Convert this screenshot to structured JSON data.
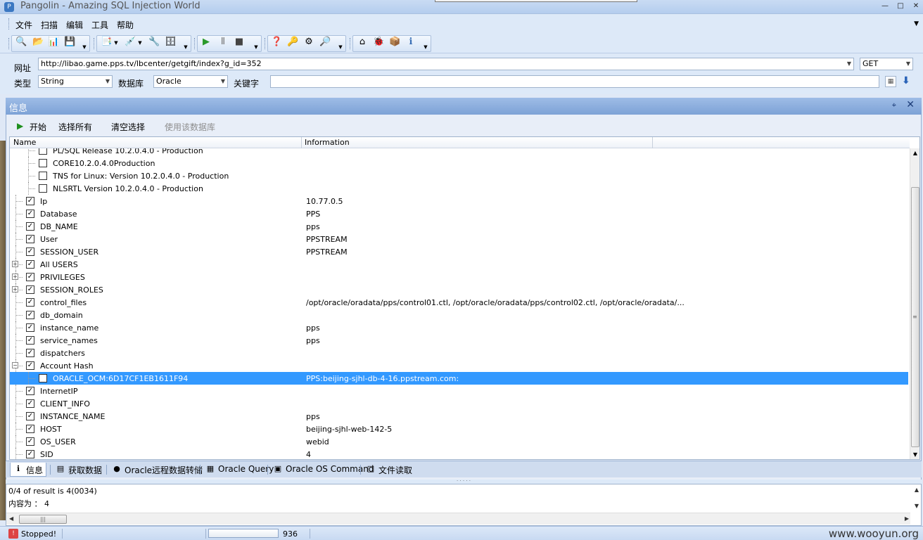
{
  "window": {
    "title": "Pangolin - Amazing SQL Injection World",
    "controls": [
      "—",
      "□",
      "✕"
    ]
  },
  "menu": [
    "文件",
    "扫描",
    "编辑",
    "工具",
    "帮助"
  ],
  "toolbar": {
    "icons": [
      "search-icon",
      "open-icon",
      "chart-icon",
      "export-icon",
      "report-icon",
      "injection-icon",
      "tools-icon",
      "database-icon",
      "play-icon",
      "pause-icon",
      "stop-icon",
      "help-icon",
      "key-icon",
      "settings-icon",
      "find-icon",
      "home-icon",
      "bug-icon",
      "package-icon",
      "info-icon"
    ],
    "glyphs": [
      "🔍",
      "📂",
      "📊",
      "💾",
      "📑",
      "💉",
      "🔧",
      "🗄",
      "▶",
      "Ⅱ",
      "■",
      "❓",
      "🔑",
      "⚙",
      "🔎",
      "⌂",
      "🐞",
      "📦",
      "ℹ"
    ]
  },
  "url": {
    "label": "网址",
    "value": "http://libao.game.pps.tv/lbcenter/getgift/index?g_id=352",
    "method": "GET"
  },
  "type": {
    "label": "类型",
    "value": "String"
  },
  "database": {
    "label": "数据库",
    "value": "Oracle"
  },
  "keyword": {
    "label": "关键字",
    "value": ""
  },
  "info_panel": {
    "title": "信息",
    "pin": "⌖",
    "close": "✕"
  },
  "actions": {
    "start": "开始",
    "select_all": "选择所有",
    "clear": "清空选择",
    "use_db": "使用该数据库"
  },
  "grid": {
    "columns": [
      "Name",
      "Information"
    ],
    "rows": [
      {
        "name": "PL/SQL Release 10.2.0.4.0 - Production",
        "info": "",
        "level": 1,
        "checked": false,
        "expander": ""
      },
      {
        "name": "CORE10.2.0.4.0Production",
        "info": "",
        "level": 1,
        "checked": false,
        "expander": ""
      },
      {
        "name": "TNS for Linux: Version 10.2.0.4.0 - Production",
        "info": "",
        "level": 1,
        "checked": false,
        "expander": ""
      },
      {
        "name": "NLSRTL Version 10.2.0.4.0 - Production",
        "info": "",
        "level": 1,
        "checked": false,
        "expander": ""
      },
      {
        "name": "Ip",
        "info": "10.77.0.5",
        "level": 0,
        "checked": true,
        "expander": ""
      },
      {
        "name": "Database",
        "info": "PPS",
        "level": 0,
        "checked": true,
        "expander": ""
      },
      {
        "name": "DB_NAME",
        "info": "pps",
        "level": 0,
        "checked": true,
        "expander": ""
      },
      {
        "name": "User",
        "info": "PPSTREAM",
        "level": 0,
        "checked": true,
        "expander": ""
      },
      {
        "name": "SESSION_USER",
        "info": "PPSTREAM",
        "level": 0,
        "checked": true,
        "expander": ""
      },
      {
        "name": "All USERS",
        "info": "",
        "level": 0,
        "checked": true,
        "expander": "+"
      },
      {
        "name": "PRIVILEGES",
        "info": "",
        "level": 0,
        "checked": true,
        "expander": "+"
      },
      {
        "name": "SESSION_ROLES",
        "info": "",
        "level": 0,
        "checked": true,
        "expander": "+"
      },
      {
        "name": "control_files",
        "info": "/opt/oracle/oradata/pps/control01.ctl, /opt/oracle/oradata/pps/control02.ctl, /opt/oracle/oradata/...",
        "level": 0,
        "checked": true,
        "expander": ""
      },
      {
        "name": "db_domain",
        "info": "",
        "level": 0,
        "checked": true,
        "expander": ""
      },
      {
        "name": "instance_name",
        "info": "pps",
        "level": 0,
        "checked": true,
        "expander": ""
      },
      {
        "name": "service_names",
        "info": "pps",
        "level": 0,
        "checked": true,
        "expander": ""
      },
      {
        "name": "dispatchers",
        "info": "",
        "level": 0,
        "checked": true,
        "expander": ""
      },
      {
        "name": "Account Hash",
        "info": "",
        "level": 0,
        "checked": true,
        "expander": "−"
      },
      {
        "name": "ORACLE_OCM:6D17CF1EB1611F94",
        "info": "PPS:beijing-sjhl-db-4-16.ppstream.com:",
        "level": 1,
        "checked": false,
        "expander": "",
        "selected": true
      },
      {
        "name": "InternetIP",
        "info": "",
        "level": 0,
        "checked": true,
        "expander": ""
      },
      {
        "name": "CLIENT_INFO",
        "info": "",
        "level": 0,
        "checked": true,
        "expander": ""
      },
      {
        "name": "INSTANCE_NAME",
        "info": "pps",
        "level": 0,
        "checked": true,
        "expander": ""
      },
      {
        "name": "HOST",
        "info": "beijing-sjhl-web-142-5",
        "level": 0,
        "checked": true,
        "expander": ""
      },
      {
        "name": "OS_USER",
        "info": "webid",
        "level": 0,
        "checked": true,
        "expander": ""
      },
      {
        "name": "SID",
        "info": "4",
        "level": 0,
        "checked": true,
        "expander": ""
      }
    ]
  },
  "tabs": [
    {
      "label": "信息",
      "icon": "info-icon",
      "glyph": "ℹ",
      "active": true
    },
    {
      "label": "获取数据",
      "icon": "database-icon",
      "glyph": "▤",
      "active": false
    },
    {
      "label": "Oracle远程数据转储",
      "icon": "globe-icon",
      "glyph": "●",
      "active": false
    },
    {
      "label": "Oracle Query",
      "icon": "sql-icon",
      "glyph": "▦",
      "active": false
    },
    {
      "label": "Oracle OS Command",
      "icon": "console-icon",
      "glyph": "▣",
      "active": false
    },
    {
      "label": "文件读取",
      "icon": "file-icon",
      "glyph": "□",
      "active": false
    }
  ],
  "output": {
    "line1": "0/4 of result is 4(0034)",
    "line2": "内容为 ： 4"
  },
  "status": {
    "text": "Stopped!",
    "count": "936",
    "watermark": "www.wooyun.org"
  }
}
